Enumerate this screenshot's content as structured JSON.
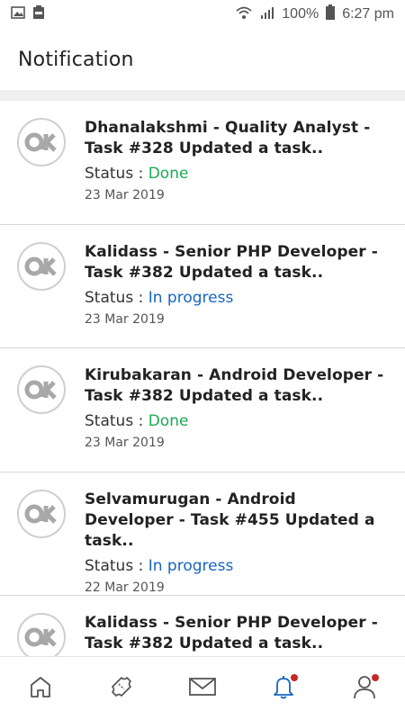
{
  "status_bar": {
    "battery_percent": "100%",
    "time": "6:27 pm",
    "icons": [
      "image-icon",
      "battery-saver-icon",
      "wifi-icon",
      "signal-icon",
      "battery-icon"
    ]
  },
  "header": {
    "title": "Notification"
  },
  "notifications": [
    {
      "title": "Dhanalakshmi - Quality Analyst - Task #328 Updated a task..",
      "status_label": "Status : ",
      "status_value": "Done",
      "date": "23 Mar 2019"
    },
    {
      "title": "Kalidass - Senior PHP Developer - Task #382 Updated a task..",
      "status_label": "Status : ",
      "status_value": "In progress",
      "date": "23 Mar 2019"
    },
    {
      "title": "Kirubakaran - Android Developer - Task #382 Updated a task..",
      "status_label": "Status : ",
      "status_value": "Done",
      "date": "23 Mar 2019"
    },
    {
      "title": "Selvamurugan - Android Developer - Task #455 Updated a task..",
      "status_label": "Status : ",
      "status_value": "In progress",
      "date": "22 Mar 2019"
    },
    {
      "title": "Kalidass - Senior PHP Developer - Task #382 Updated a task..",
      "status_label": "",
      "status_value": "",
      "date": ""
    }
  ],
  "colors": {
    "done": "#1aaa55",
    "in_progress": "#1565c0",
    "active_tab": "#1565c0",
    "badge": "#c62828"
  },
  "bottom_nav": [
    {
      "icon": "home-icon",
      "active": false,
      "badge": false
    },
    {
      "icon": "ticket-icon",
      "active": false,
      "badge": false
    },
    {
      "icon": "mail-icon",
      "active": false,
      "badge": false
    },
    {
      "icon": "bell-icon",
      "active": true,
      "badge": true
    },
    {
      "icon": "profile-icon",
      "active": false,
      "badge": true
    }
  ]
}
